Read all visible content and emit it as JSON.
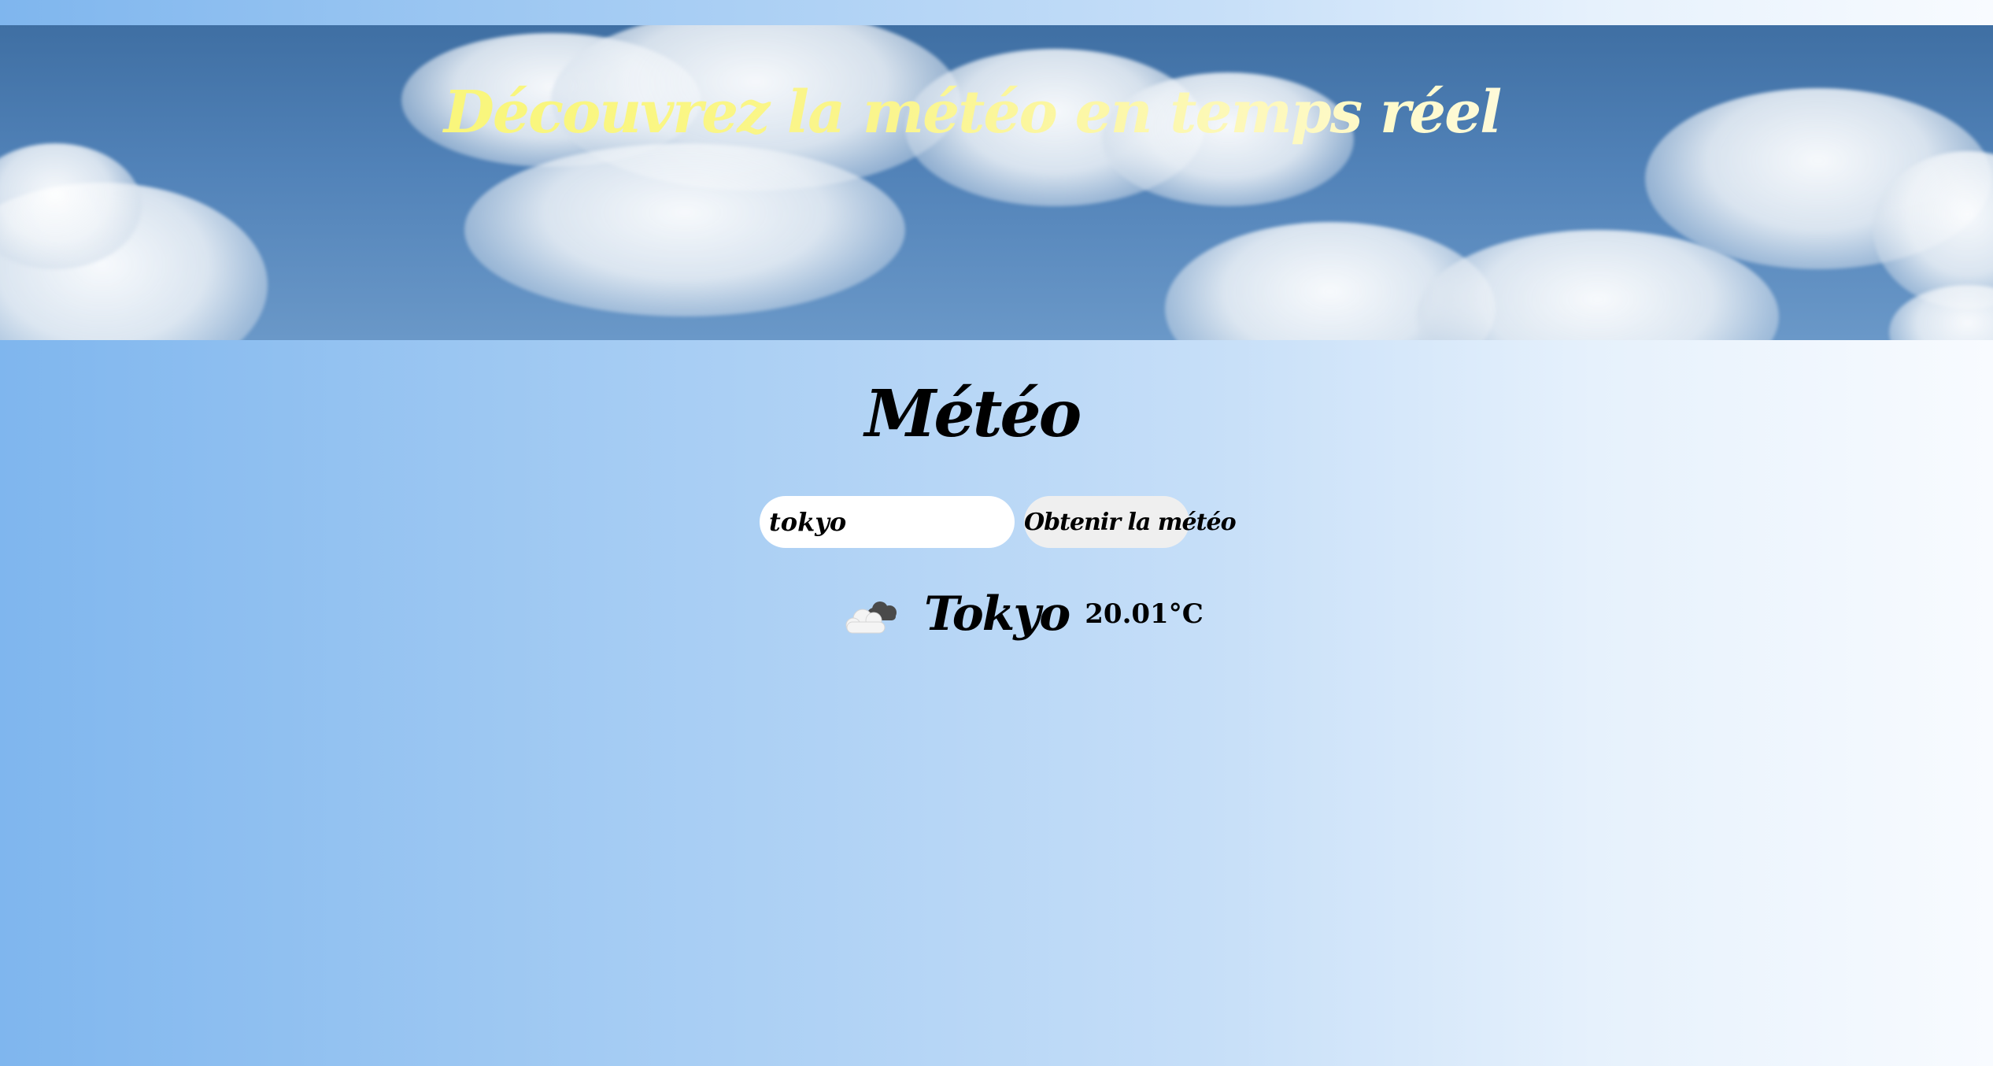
{
  "header": {
    "banner_title": "Découvrez la météo en temps réel"
  },
  "main": {
    "title": "Météo",
    "search": {
      "value": "tokyo",
      "button_label": "Obtenir la météo"
    },
    "result": {
      "icon": "broken-clouds-icon",
      "city": "Tokyo",
      "temperature": "20.01°C"
    }
  },
  "colors": {
    "banner_title_start": "#f8f86a",
    "banner_title_end": "#ffffff",
    "background_start": "#7fb6ee",
    "background_end": "#f8fbff"
  }
}
